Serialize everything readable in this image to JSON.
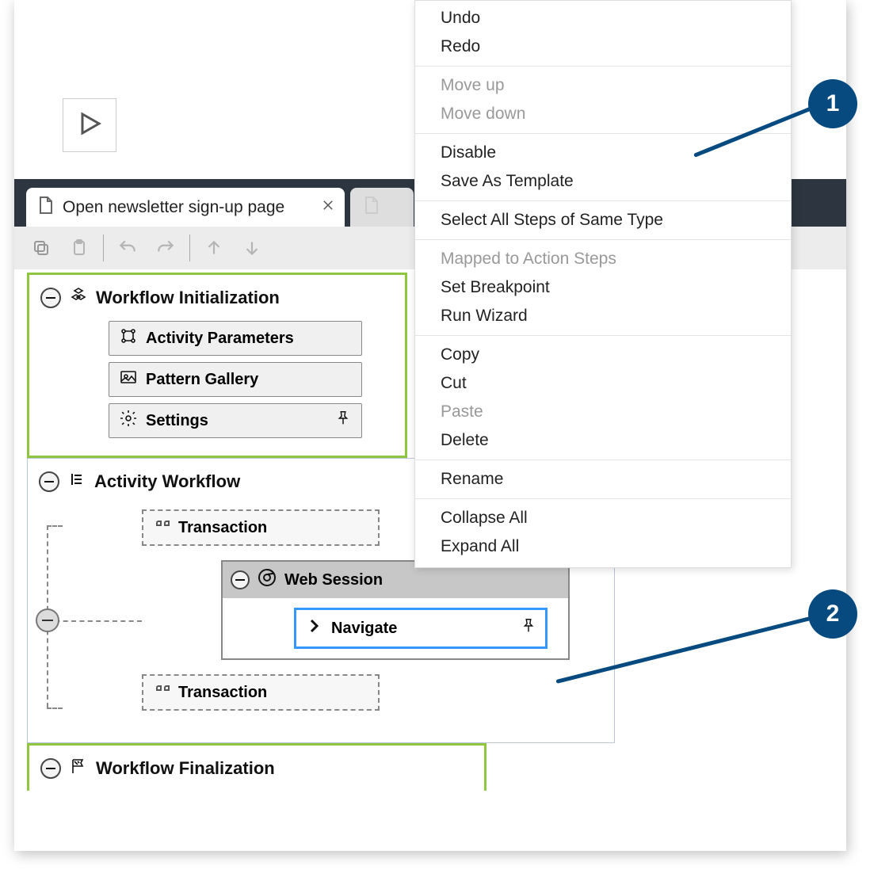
{
  "tab": {
    "title": "Open newsletter sign-up page"
  },
  "groups": {
    "init": {
      "title": "Workflow Initialization",
      "items": {
        "activityParams": "Activity Parameters",
        "patternGallery": "Pattern Gallery",
        "settings": "Settings"
      }
    },
    "activityWorkflow": {
      "title": "Activity Workflow",
      "transaction1": "Transaction",
      "transaction2": "Transaction",
      "webSession": "Web Session",
      "navigate": "Navigate"
    },
    "final": {
      "title": "Workflow Finalization"
    }
  },
  "contextMenu": {
    "undo": "Undo",
    "redo": "Redo",
    "moveUp": "Move up",
    "moveDown": "Move down",
    "disable": "Disable",
    "saveTemplate": "Save As Template",
    "selectSameType": "Select All Steps of Same Type",
    "mappedActionSteps": "Mapped to Action Steps",
    "setBreakpoint": "Set Breakpoint",
    "runWizard": "Run Wizard",
    "copy": "Copy",
    "cut": "Cut",
    "paste": "Paste",
    "delete": "Delete",
    "rename": "Rename",
    "collapseAll": "Collapse All",
    "expandAll": "Expand All"
  },
  "callouts": {
    "one": "1",
    "two": "2"
  }
}
